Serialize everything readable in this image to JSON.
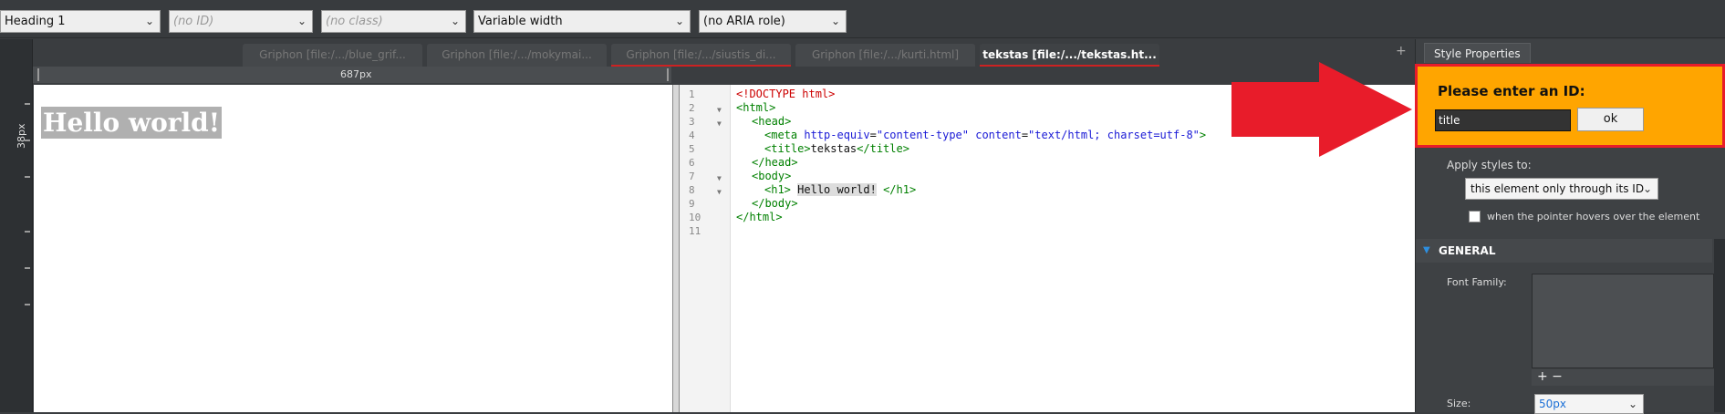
{
  "toolbar": {
    "element_select": "Heading 1",
    "id_placeholder": "(no ID)",
    "class_placeholder": "(no class)",
    "width_select": "Variable width",
    "aria_select": "(no ARIA role)"
  },
  "tabs": [
    {
      "label": "Griphon [file:/.../blue_grif..."
    },
    {
      "label": "Griphon [file:/.../mokymai..."
    },
    {
      "label": "Griphon [file:/.../siustis_di..."
    },
    {
      "label": "Griphon [file:/.../kurti.html]"
    },
    {
      "label": "tekstas [file:/.../tekstas.ht..."
    }
  ],
  "ruler": {
    "width_label": "687px",
    "height_label": "38px"
  },
  "design": {
    "heading_text": "Hello world!"
  },
  "code": {
    "line_numbers": [
      "1",
      "2",
      "3",
      "4",
      "5",
      "6",
      "7",
      "8",
      "9",
      "10",
      "11"
    ],
    "doctype": "<!DOCTYPE html>",
    "html_open": "<html>",
    "head_open": "<head>",
    "meta_open": "<meta",
    "meta_attr1": "http-equiv",
    "meta_eq": "=",
    "meta_val1": "\"content-type\"",
    "meta_attr2": "content",
    "meta_val2": "\"text/html; charset=utf-8\"",
    "meta_close": ">",
    "title_open": "<title>",
    "title_text": "tekstas",
    "title_close": "</title>",
    "head_close": "</head>",
    "body_open": "<body>",
    "h1_open": "<h1>",
    "h1_text": "Hello world!",
    "h1_close": "</h1>",
    "body_close": "</body>",
    "html_close": "</html>"
  },
  "panel": {
    "tab_label": "Style Properties",
    "id_prompt": "Please enter an ID:",
    "id_value": "title",
    "ok_label": "ok",
    "apply_label": "Apply styles to:",
    "apply_select": "this element only through its ID",
    "hover_label": "when the pointer hovers over the element",
    "section_general": "GENERAL",
    "font_family_label": "Font Family:",
    "font_buttons": "+ −",
    "size_label": "Size:",
    "size_value": "50px"
  },
  "tab_plus": "+",
  "colors": {
    "highlight_box": "#ffa500",
    "arrow": "#e81c2a",
    "accent": "#2d8fe0"
  }
}
